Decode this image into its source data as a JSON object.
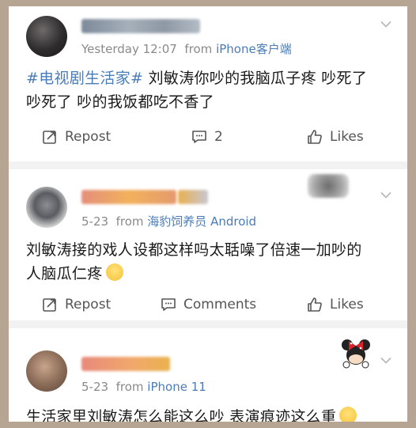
{
  "post": {
    "timestamp": "Yesterday 12:07",
    "from_word": "from",
    "source": "iPhone客户端",
    "topic": "#电视剧生活家#",
    "text_line1": " 刘敏涛你吵的我脑瓜子疼  吵死了",
    "text_line2": "吵死了 吵的我饭都吃不香了",
    "actions": {
      "repost": "Repost",
      "comments": "2",
      "likes": "Likes"
    },
    "icons": {
      "menu": "chevron-down-icon",
      "repost": "repost-icon",
      "comment": "comment-icon",
      "like": "thumbs-up-icon"
    }
  },
  "comment1": {
    "date": "5-23",
    "from_word": "from",
    "source": "海豹饲养员 Android",
    "text_line1": "刘敏涛接的戏人设都这样吗太聒噪了倍速一加吵的",
    "text_line2": "人脑瓜仁疼",
    "actions": {
      "repost": "Repost",
      "comments": "Comments",
      "likes": "Likes"
    }
  },
  "comment2": {
    "date": "5-23",
    "from_word": "from",
    "source": "iPhone 11",
    "text_line1": "生活家里刘敏涛怎么能这么吵 表演痕迹这么重"
  },
  "colors": {
    "link": "#4a7cb8",
    "meta": "#8a8a8a",
    "text": "#1a1a1a",
    "frame": "#b7a593"
  }
}
